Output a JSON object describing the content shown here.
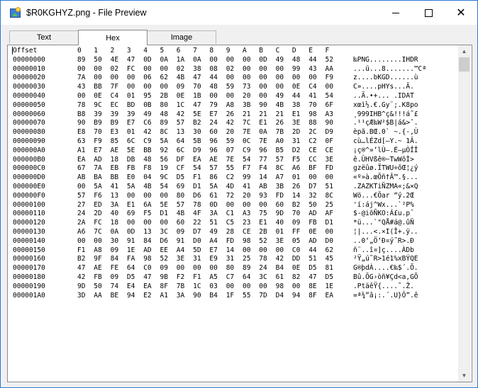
{
  "window": {
    "title": "$R0KGHYZ.png - File Preview",
    "min_glyph": "",
    "max_glyph": "",
    "close_glyph": "✕"
  },
  "tabs": [
    {
      "label": "Text"
    },
    {
      "label": "Hex"
    },
    {
      "label": "Image"
    }
  ],
  "header": {
    "offset": "Offset",
    "cols": [
      "0",
      "1",
      "2",
      "3",
      "4",
      "5",
      "6",
      "7",
      "8",
      "9",
      "A",
      "B",
      "C",
      "D",
      "E",
      "F"
    ]
  },
  "rows": [
    {
      "offset": "00000000",
      "bytes": [
        "89",
        "50",
        "4E",
        "47",
        "0D",
        "0A",
        "1A",
        "0A",
        "00",
        "00",
        "00",
        "0D",
        "49",
        "48",
        "44",
        "52"
      ],
      "text": "‰PNG........IHDR"
    },
    {
      "offset": "00000010",
      "bytes": [
        "00",
        "00",
        "02",
        "FC",
        "00",
        "00",
        "02",
        "38",
        "08",
        "02",
        "00",
        "00",
        "00",
        "99",
        "43",
        "AA"
      ],
      "text": "...ü...8.......™Cª"
    },
    {
      "offset": "00000020",
      "bytes": [
        "7A",
        "00",
        "00",
        "00",
        "06",
        "62",
        "4B",
        "47",
        "44",
        "00",
        "00",
        "00",
        "00",
        "00",
        "00",
        "F9"
      ],
      "text": "z....bKGD......ù"
    },
    {
      "offset": "00000030",
      "bytes": [
        "43",
        "BB",
        "7F",
        "00",
        "00",
        "00",
        "09",
        "70",
        "48",
        "59",
        "73",
        "00",
        "00",
        "0E",
        "C4",
        "00"
      ],
      "text": "C»....pHYs...Ä."
    },
    {
      "offset": "00000040",
      "bytes": [
        "00",
        "0E",
        "C4",
        "01",
        "95",
        "2B",
        "0E",
        "1B",
        "00",
        "00",
        "20",
        "00",
        "49",
        "44",
        "41",
        "54"
      ],
      "text": "..Ä.•+... .IDAT"
    },
    {
      "offset": "00000050",
      "bytes": [
        "78",
        "9C",
        "EC",
        "BD",
        "0B",
        "80",
        "1C",
        "47",
        "79",
        "A8",
        "3B",
        "90",
        "4B",
        "38",
        "70",
        "6F"
      ],
      "text": "xœì½.€.Gy¨;.K8po"
    },
    {
      "offset": "00000060",
      "bytes": [
        "B8",
        "39",
        "39",
        "39",
        "49",
        "48",
        "42",
        "5E",
        "E7",
        "26",
        "21",
        "21",
        "21",
        "E1",
        "98",
        "A3"
      ],
      "text": "¸999IHB^ç&!!!á˜£"
    },
    {
      "offset": "00000070",
      "bytes": [
        "90",
        "B9",
        "B9",
        "E7",
        "C6",
        "89",
        "57",
        "B2",
        "24",
        "42",
        "7C",
        "E1",
        "26",
        "3E",
        "88",
        "90"
      ],
      "text": ".¹¹çÆ‰W²$B|á&>ˆ."
    },
    {
      "offset": "00000080",
      "bytes": [
        "E8",
        "70",
        "E3",
        "01",
        "42",
        "8C",
        "13",
        "30",
        "60",
        "20",
        "7E",
        "0A",
        "7B",
        "2D",
        "2C",
        "D9"
      ],
      "text": "èpã.BŒ.0` ~.{-,Ù"
    },
    {
      "offset": "00000090",
      "bytes": [
        "63",
        "F9",
        "85",
        "6C",
        "C9",
        "5A",
        "64",
        "5B",
        "96",
        "59",
        "0C",
        "7E",
        "A0",
        "31",
        "C2",
        "0F"
      ],
      "text": "cù…lÉZd[–Y.~ 1Â."
    },
    {
      "offset": "000000A0",
      "bytes": [
        "A1",
        "E7",
        "AE",
        "5E",
        "BB",
        "92",
        "6C",
        "D9",
        "96",
        "07",
        "C9",
        "96",
        "B5",
        "D2",
        "CE",
        "CE"
      ],
      "text": "¡ç®^»’lÙ–.É–µÒÎÎ"
    },
    {
      "offset": "000000B0",
      "bytes": [
        "EA",
        "AD",
        "18",
        "DB",
        "48",
        "56",
        "DF",
        "EA",
        "AE",
        "7E",
        "54",
        "77",
        "57",
        "F5",
        "CC",
        "3E"
      ],
      "text": "ê­.ÛHVßê®~TwWõÌ>"
    },
    {
      "offset": "000000C0",
      "bytes": [
        "67",
        "7A",
        "EB",
        "FB",
        "F8",
        "19",
        "CF",
        "54",
        "57",
        "55",
        "F7",
        "F4",
        "8C",
        "A6",
        "BF",
        "FD"
      ],
      "text": "gzëûø.ÏTWU÷ôŒ¦¿ý"
    },
    {
      "offset": "000000D0",
      "bytes": [
        "AB",
        "BA",
        "BB",
        "E0",
        "04",
        "9C",
        "D5",
        "F1",
        "86",
        "C2",
        "99",
        "14",
        "A7",
        "01",
        "00",
        "00"
      ],
      "text": "«º»à.œÕñ†Â™.§..."
    },
    {
      "offset": "000000E0",
      "bytes": [
        "00",
        "5A",
        "41",
        "5A",
        "4B",
        "54",
        "69",
        "D1",
        "5A",
        "4D",
        "41",
        "AB",
        "3B",
        "26",
        "D7",
        "51"
      ],
      "text": ".ZAZKTiÑZMA«;&×Q"
    },
    {
      "offset": "000000F0",
      "bytes": [
        "57",
        "F6",
        "13",
        "00",
        "00",
        "00",
        "80",
        "D6",
        "61",
        "72",
        "20",
        "93",
        "FD",
        "14",
        "32",
        "8C"
      ],
      "text": "Wö...€Öar “ý.2Œ"
    },
    {
      "offset": "00000100",
      "bytes": [
        "27",
        "ED",
        "3A",
        "E1",
        "6A",
        "5E",
        "57",
        "78",
        "0D",
        "00",
        "00",
        "00",
        "60",
        "B2",
        "50",
        "25"
      ],
      "text": "'í:áj^Wx...`²P%"
    },
    {
      "offset": "00000110",
      "bytes": [
        "24",
        "2D",
        "40",
        "69",
        "F5",
        "D1",
        "4B",
        "4F",
        "3A",
        "C1",
        "A3",
        "75",
        "9D",
        "70",
        "AD",
        "AF"
      ],
      "text": "$-@iõÑKO:Á£u.p­¯"
    },
    {
      "offset": "00000120",
      "bytes": [
        "2A",
        "FC",
        "18",
        "00",
        "00",
        "00",
        "60",
        "22",
        "51",
        "C5",
        "23",
        "E1",
        "40",
        "09",
        "FB",
        "D1"
      ],
      "text": "*ü...`\"QÅ#á@.ûÑ"
    },
    {
      "offset": "00000130",
      "bytes": [
        "A6",
        "7C",
        "0A",
        "0D",
        "13",
        "3C",
        "09",
        "D7",
        "49",
        "28",
        "CE",
        "2B",
        "01",
        "FF",
        "0E",
        "00"
      ],
      "text": "¦|...<.×I(Î+.ÿ.."
    },
    {
      "offset": "00000140",
      "bytes": [
        "00",
        "00",
        "30",
        "91",
        "84",
        "D6",
        "91",
        "D0",
        "A4",
        "FD",
        "98",
        "52",
        "3E",
        "05",
        "AD",
        "D0"
      ],
      "text": "..0‘„Ö‘Ð¤ý˜R>.­Ð"
    },
    {
      "offset": "00000150",
      "bytes": [
        "F1",
        "A8",
        "09",
        "1E",
        "AD",
        "EE",
        "A4",
        "5D",
        "E7",
        "14",
        "00",
        "00",
        "00",
        "C0",
        "44",
        "62"
      ],
      "text": "ñ¨..­î¤]ç....ÀDb"
    },
    {
      "offset": "00000160",
      "bytes": [
        "B2",
        "9F",
        "84",
        "FA",
        "98",
        "52",
        "3E",
        "31",
        "E9",
        "31",
        "25",
        "78",
        "42",
        "DD",
        "51",
        "45"
      ],
      "text": "²Ÿ„ú˜R>1é1%xBÝQE"
    },
    {
      "offset": "00000170",
      "bytes": [
        "47",
        "AE",
        "FE",
        "64",
        "C0",
        "09",
        "00",
        "00",
        "00",
        "80",
        "89",
        "24",
        "B4",
        "0E",
        "D5",
        "81"
      ],
      "text": "G®þdÀ....€‰$´.Õ."
    },
    {
      "offset": "00000180",
      "bytes": [
        "42",
        "FB",
        "09",
        "D5",
        "47",
        "9B",
        "F2",
        "F1",
        "A5",
        "C7",
        "64",
        "3C",
        "61",
        "82",
        "47",
        "D5"
      ],
      "text": "Bû.ÕG›òñ¥Çd<a‚GÕ"
    },
    {
      "offset": "00000190",
      "bytes": [
        "9D",
        "50",
        "74",
        "E4",
        "EA",
        "8F",
        "7B",
        "1C",
        "03",
        "00",
        "00",
        "00",
        "98",
        "00",
        "8E",
        "1E"
      ],
      "text": ".PtäêŸ{....˜.Ž."
    },
    {
      "offset": "000001A0",
      "bytes": [
        "3D",
        "AA",
        "BE",
        "94",
        "E2",
        "A1",
        "3A",
        "90",
        "B4",
        "1F",
        "55",
        "7D",
        "D4",
        "94",
        "8F",
        "EA"
      ],
      "text": "=ª¾”â¡:.´.U}Ô”.ê"
    }
  ]
}
